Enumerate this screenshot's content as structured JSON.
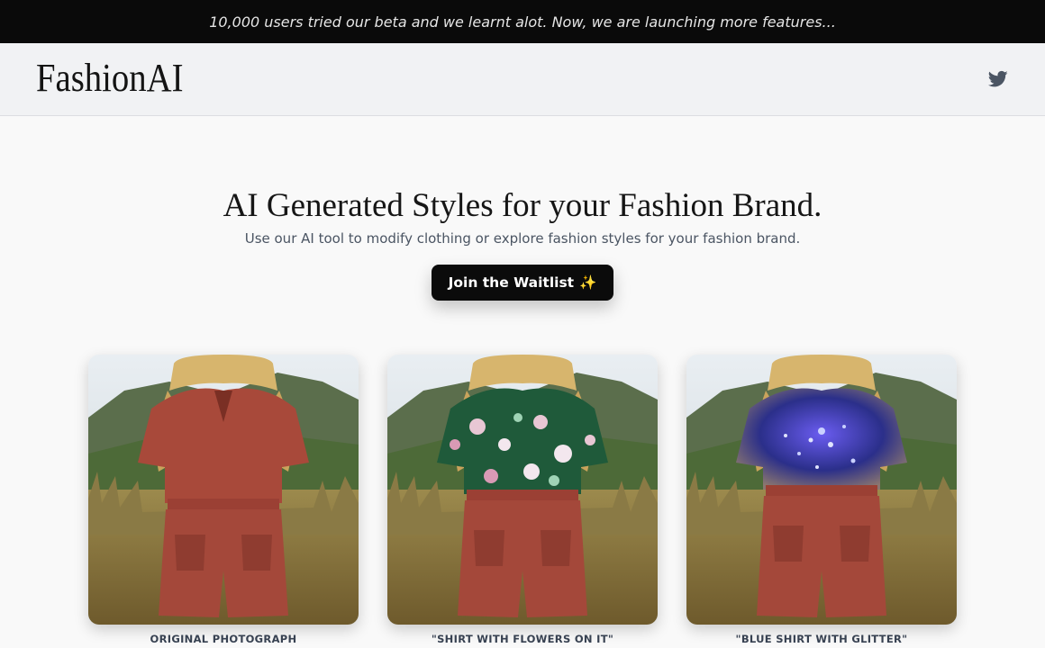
{
  "announcement": {
    "text": "10,000 users tried our beta and we learnt alot. Now, we are launching more features..."
  },
  "header": {
    "logo": "FashionAI",
    "social_icon": "twitter-icon"
  },
  "hero": {
    "title": "AI Generated Styles for your Fashion Brand.",
    "subtitle": "Use our AI tool to modify clothing or explore fashion styles for your fashion brand.",
    "cta_label": "Join the Waitlist",
    "cta_emoji": "✨"
  },
  "gallery": [
    {
      "caption": "ORIGINAL PHOTOGRAPH",
      "shirt": "plain-rust-shirt"
    },
    {
      "caption": "\"SHIRT WITH FLOWERS ON IT\"",
      "shirt": "green-floral-shirt"
    },
    {
      "caption": "\"BLUE SHIRT WITH GLITTER\"",
      "shirt": "blue-glitter-shirt"
    }
  ],
  "colors": {
    "banner_bg": "#0a0a0a",
    "nav_bg": "#f1f2f4",
    "page_bg": "#f9f9f9",
    "cta_bg": "#0b0b0b",
    "outfit_rust": "#a8493a",
    "floral_green": "#1f5a3a",
    "glitter_blue": "#2b2f8a"
  }
}
